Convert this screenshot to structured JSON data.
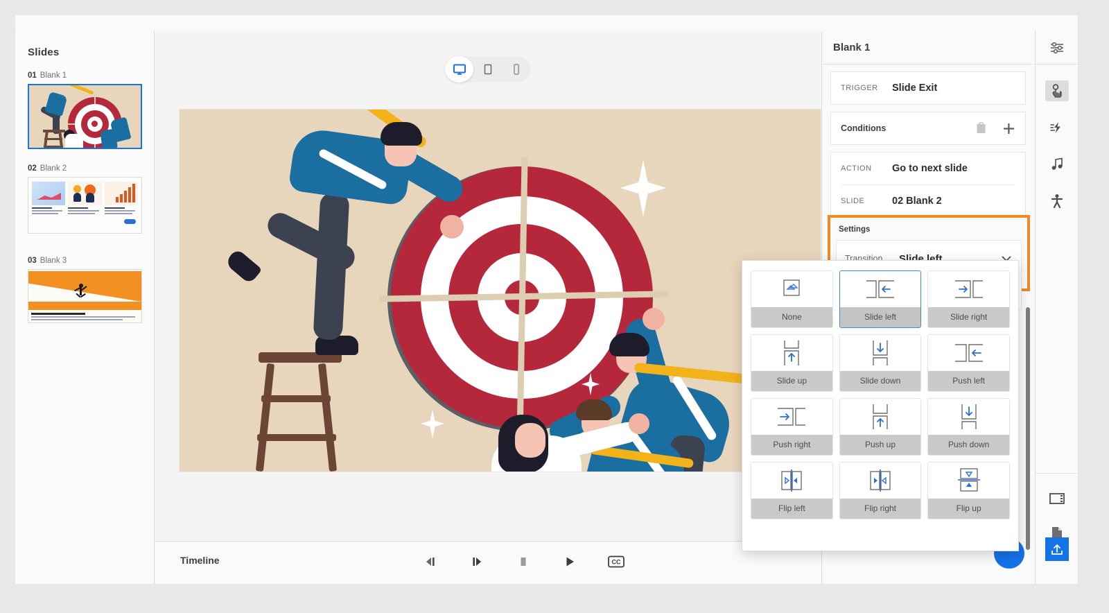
{
  "app": {
    "slides_panel_title": "Slides",
    "timeline_label": "Timeline"
  },
  "slides": {
    "title": "Slides",
    "items": [
      {
        "number": "01",
        "name": "Blank 1",
        "selected": true
      },
      {
        "number": "02",
        "name": "Blank 2",
        "selected": false
      },
      {
        "number": "03",
        "name": "Blank 3",
        "selected": false
      }
    ]
  },
  "device_bar": {
    "options": [
      {
        "icon": "desktop-icon",
        "label": "Desktop",
        "active": true
      },
      {
        "icon": "tablet-icon",
        "label": "Tablet",
        "active": false
      },
      {
        "icon": "mobile-icon",
        "label": "Mobile",
        "active": false
      }
    ]
  },
  "timeline": {
    "label": "Timeline",
    "controls": [
      {
        "icon": "step-back-icon",
        "label": "Previous frame"
      },
      {
        "icon": "step-forward-icon",
        "label": "Next frame"
      },
      {
        "icon": "stop-icon",
        "label": "Stop"
      },
      {
        "icon": "play-icon",
        "label": "Play"
      },
      {
        "icon": "closed-caption-icon",
        "label": "CC"
      }
    ]
  },
  "properties": {
    "title": "Blank 1",
    "trigger": {
      "key": "TRIGGER",
      "value": "Slide Exit"
    },
    "conditions": {
      "key": "Conditions",
      "paste_icon": "clipboard-icon",
      "add_icon": "plus-icon"
    },
    "action": {
      "key": "ACTION",
      "value": "Go to next slide"
    },
    "slide": {
      "key": "SLIDE",
      "value": "02 Blank 2"
    },
    "settings": {
      "label": "Settings",
      "transition": {
        "key": "Transition",
        "value": "Slide left",
        "chevron_icon": "chevron-down-icon"
      },
      "highlight_color": "#ef8b22"
    }
  },
  "transition_dropdown": {
    "selected": "Slide left",
    "accent_color": "#3f8ae0",
    "options": [
      {
        "label": "None",
        "icon": "transition-none-icon",
        "selected": false
      },
      {
        "label": "Slide left",
        "icon": "transition-slide-left-icon",
        "selected": true
      },
      {
        "label": "Slide right",
        "icon": "transition-slide-right-icon",
        "selected": false
      },
      {
        "label": "Slide up",
        "icon": "transition-slide-up-icon",
        "selected": false
      },
      {
        "label": "Slide down",
        "icon": "transition-slide-down-icon",
        "selected": false
      },
      {
        "label": "Push left",
        "icon": "transition-push-left-icon",
        "selected": false
      },
      {
        "label": "Push right",
        "icon": "transition-push-right-icon",
        "selected": false
      },
      {
        "label": "Push up",
        "icon": "transition-push-up-icon",
        "selected": false
      },
      {
        "label": "Push down",
        "icon": "transition-push-down-icon",
        "selected": false
      },
      {
        "label": "Flip left",
        "icon": "transition-flip-left-icon",
        "selected": false
      },
      {
        "label": "Flip right",
        "icon": "transition-flip-right-icon",
        "selected": false
      },
      {
        "label": "Flip up",
        "icon": "transition-flip-up-icon",
        "selected": false
      }
    ]
  },
  "icon_rail": {
    "top_items": [
      {
        "icon": "properties-sliders-icon",
        "label": "Properties",
        "active": false
      },
      {
        "icon": "interactions-hand-icon",
        "label": "Interactions",
        "active": true
      },
      {
        "icon": "animation-bolt-icon",
        "label": "Animation",
        "active": false
      },
      {
        "icon": "audio-music-icon",
        "label": "Audio",
        "active": false
      },
      {
        "icon": "accessibility-icon",
        "label": "Accessibility",
        "active": false
      }
    ],
    "bottom_items": [
      {
        "icon": "layout-panel-icon",
        "label": "Layout",
        "active": false
      },
      {
        "icon": "document-icon",
        "label": "Assets",
        "active": false
      }
    ],
    "publish": {
      "icon": "publish-upload-icon",
      "label": "Publish",
      "color": "#1473e6"
    }
  }
}
